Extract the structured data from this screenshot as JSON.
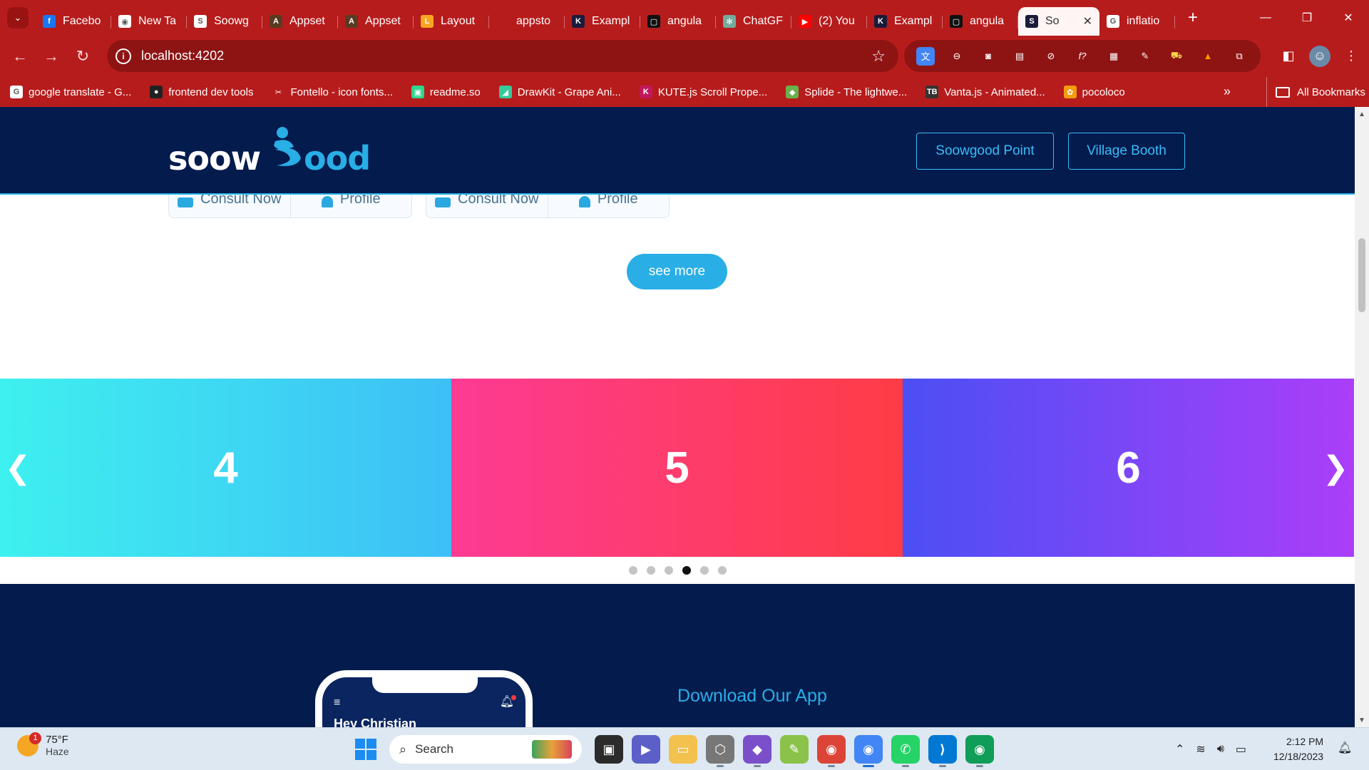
{
  "browser": {
    "tabs": [
      {
        "title": "Facebo",
        "icon": "facebook-icon",
        "color": "#1877f2",
        "glyph": "f"
      },
      {
        "title": "New Ta",
        "icon": "chrome-icon",
        "color": "#ffffff",
        "glyph": "◉"
      },
      {
        "title": "Soowg",
        "icon": "soowgood-favicon",
        "color": "#ffffff",
        "glyph": "S"
      },
      {
        "title": "Appset",
        "icon": "appset-icon",
        "color": "#5a3a22",
        "glyph": "A"
      },
      {
        "title": "Appset",
        "icon": "appset-icon",
        "color": "#5a3a22",
        "glyph": "A"
      },
      {
        "title": "Layout",
        "icon": "layout-icon",
        "color": "#f6a623",
        "glyph": "L"
      },
      {
        "title": "appsto",
        "icon": "blank-icon",
        "color": "transparent",
        "glyph": ""
      },
      {
        "title": "Exampl",
        "icon": "kute-icon",
        "color": "#1b1b3a",
        "glyph": "K"
      },
      {
        "title": "angula",
        "icon": "angular-icon",
        "color": "#111111",
        "glyph": "▢"
      },
      {
        "title": "ChatGF",
        "icon": "chatgpt-icon",
        "color": "#74aa9c",
        "glyph": "✻"
      },
      {
        "title": "(2) You",
        "icon": "youtube-icon",
        "color": "#ff0000",
        "glyph": "▶"
      },
      {
        "title": "Exampl",
        "icon": "kute-icon",
        "color": "#1b1b3a",
        "glyph": "K"
      },
      {
        "title": "angula",
        "icon": "angular-icon",
        "color": "#111111",
        "glyph": "▢"
      },
      {
        "title": "So",
        "icon": "soowgood-favicon",
        "color": "#1b1b3a",
        "glyph": "S",
        "active": true
      },
      {
        "title": "inflatio",
        "icon": "google-icon",
        "color": "#ffffff",
        "glyph": "G"
      }
    ],
    "url": "localhost:4202",
    "bookmarks": [
      {
        "label": "google translate - G...",
        "icon": "google-icon",
        "color": "#ffffff",
        "glyph": "G"
      },
      {
        "label": "frontend dev tools",
        "icon": "github-icon",
        "color": "#222222",
        "glyph": "●"
      },
      {
        "label": "Fontello - icon fonts...",
        "icon": "fontello-icon",
        "color": "transparent",
        "glyph": "✂"
      },
      {
        "label": "readme.so",
        "icon": "readme-icon",
        "color": "#2fd48f",
        "glyph": "▣"
      },
      {
        "label": "DrawKit - Grape Ani...",
        "icon": "drawkit-icon",
        "color": "#37c99b",
        "glyph": "◢"
      },
      {
        "label": "KUTE.js Scroll Prope...",
        "icon": "kute-icon",
        "color": "#c2185b",
        "glyph": "K"
      },
      {
        "label": "Splide - The lightwe...",
        "icon": "splide-icon",
        "color": "#6ab04c",
        "glyph": "◆"
      },
      {
        "label": "Vanta.js - Animated...",
        "icon": "vanta-icon",
        "color": "#333333",
        "glyph": "TB"
      },
      {
        "label": "pocoloco",
        "icon": "pocoloco-icon",
        "color": "#f39c12",
        "glyph": "✿"
      }
    ],
    "all_bookmarks": "All Bookmarks"
  },
  "site": {
    "logo_alt": "soowgood",
    "header_buttons": [
      "Soowgood Point",
      "Village Booth"
    ],
    "cards": [
      {
        "consult": "Consult Now",
        "profile": "Profile"
      },
      {
        "consult": "Consult Now",
        "profile": "Profile"
      }
    ],
    "see_more": "see more",
    "slides": [
      "4",
      "5",
      "6"
    ],
    "dots": 6,
    "active_dot": 4,
    "app_section": {
      "title": "Download Our App",
      "phone_greeting": "Hey Christian"
    }
  },
  "taskbar": {
    "weather_temp": "75°F",
    "weather_desc": "Haze",
    "weather_badge": "1",
    "search_placeholder": "Search",
    "time": "2:12 PM",
    "date": "12/18/2023"
  }
}
